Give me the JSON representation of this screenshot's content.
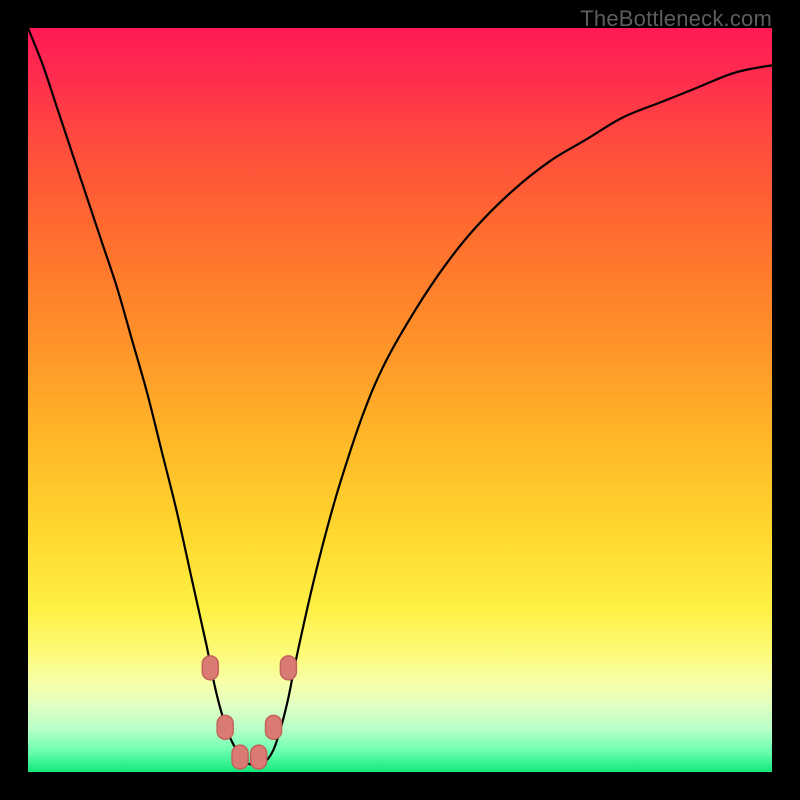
{
  "watermark": "TheBottleneck.com",
  "chart_data": {
    "type": "line",
    "title": "",
    "xlabel": "",
    "ylabel": "",
    "xlim": [
      0,
      100
    ],
    "ylim": [
      0,
      100
    ],
    "x": [
      0,
      2,
      4,
      6,
      8,
      10,
      12,
      14,
      16,
      18,
      20,
      22,
      24,
      25,
      26,
      27,
      28,
      29,
      30,
      31,
      32,
      33,
      34,
      35,
      36,
      38,
      40,
      42,
      45,
      48,
      52,
      56,
      60,
      65,
      70,
      75,
      80,
      85,
      90,
      95,
      100
    ],
    "values": [
      100,
      95,
      89,
      83,
      77,
      71,
      65,
      58,
      51,
      43,
      35,
      26,
      17,
      12,
      8,
      5,
      3,
      1.5,
      1,
      1,
      1.5,
      3,
      6,
      10,
      15,
      24,
      32,
      39,
      48,
      55,
      62,
      68,
      73,
      78,
      82,
      85,
      88,
      90,
      92,
      94,
      95
    ],
    "markers_x": [
      24.5,
      26.5,
      28.5,
      31,
      33,
      35
    ],
    "markers_y": [
      14,
      6,
      2,
      2,
      6,
      14
    ],
    "gradient_stops": [
      {
        "offset": 0.0,
        "color": "#ff1a55"
      },
      {
        "offset": 0.06,
        "color": "#ff2a4f"
      },
      {
        "offset": 0.15,
        "color": "#ff4a3e"
      },
      {
        "offset": 0.28,
        "color": "#ff6e2e"
      },
      {
        "offset": 0.42,
        "color": "#ff922a"
      },
      {
        "offset": 0.56,
        "color": "#ffb928"
      },
      {
        "offset": 0.68,
        "color": "#ffd82e"
      },
      {
        "offset": 0.78,
        "color": "#fff044"
      },
      {
        "offset": 0.84,
        "color": "#fdfb78"
      },
      {
        "offset": 0.88,
        "color": "#f7ffa8"
      },
      {
        "offset": 0.91,
        "color": "#e2ffc2"
      },
      {
        "offset": 0.94,
        "color": "#baffc8"
      },
      {
        "offset": 0.97,
        "color": "#72ffb4"
      },
      {
        "offset": 1.0,
        "color": "#12e87a"
      }
    ]
  }
}
